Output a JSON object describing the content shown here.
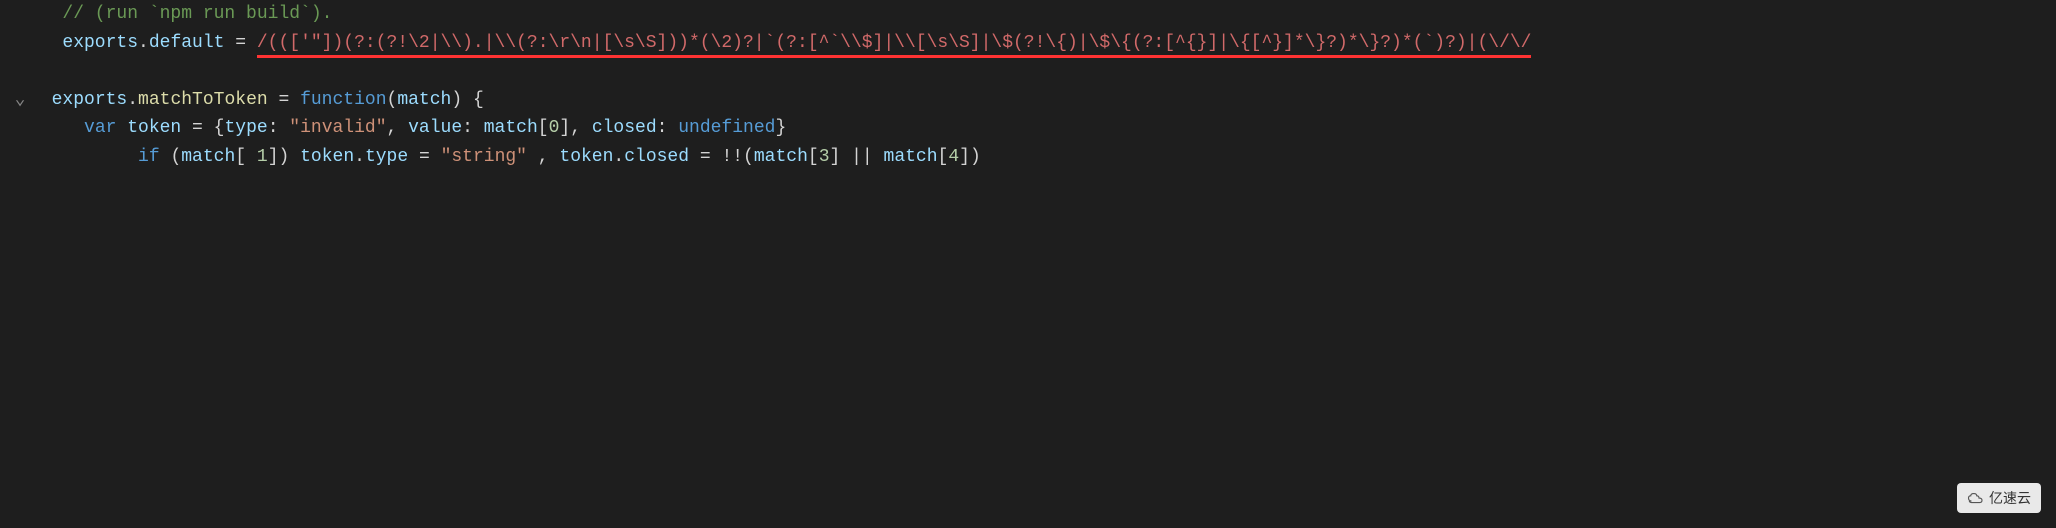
{
  "code": {
    "line1": {
      "comment": "// (run `npm run build`)."
    },
    "line2": {
      "prefix_exports": "exports",
      "dot1": ".",
      "default_prop": "default",
      "equals": " = ",
      "regex_text": "/((['\"])(?:(?!\\2|\\\\).|\\\\(?:\\r\\n|[\\s\\S]))*(\\2)?|`(?:[^`\\\\$]|\\\\[\\s\\S]|\\$(?!\\{)|\\$\\{(?:[^{}]|\\{[^}]*\\}?)*\\}?)*(`)?)|(\\/\\/"
    },
    "line3": {
      "exports": "exports",
      "dot": ".",
      "matchToToken": "matchToToken",
      "equals": " = ",
      "function_kw": "function",
      "paren_open": "(",
      "param": "match",
      "paren_close": ")",
      "brace_open": " {"
    },
    "line4": {
      "var_kw": "var",
      "token_var": " token ",
      "equals": "= ",
      "brace_open": "{",
      "type_key": "type",
      "colon1": ": ",
      "invalid_str": "\"invalid\"",
      "comma1": ", ",
      "value_key": "value",
      "colon2": ": ",
      "match_var": "match",
      "bracket_open": "[",
      "zero": "0",
      "bracket_close": "]",
      "comma2": ", ",
      "closed_key": "closed",
      "colon3": ": ",
      "undefined_kw": "undefined",
      "brace_close": "}"
    },
    "line5": {
      "if_kw": "if",
      "paren_open": " (",
      "match1": "match",
      "bracket1_open": "[ ",
      "one": "1",
      "bracket1_close": "]",
      "paren_close": ") ",
      "token1": "token",
      "dot1": ".",
      "type_prop": "type",
      "eq1": " = ",
      "string_str": "\"string\"",
      "spacer": " , ",
      "token2": "token",
      "dot2": ".",
      "closed_prop": "closed",
      "eq2": " = ",
      "bang": "!!",
      "paren2_open": "(",
      "match3": "match",
      "bracket3_open": "[",
      "three": "3",
      "bracket3_close": "]",
      "or_op": " || ",
      "match4": "match",
      "bracket4_open": "[",
      "four": "4",
      "bracket4_close": "]",
      "paren2_close": ")"
    }
  },
  "watermark": {
    "text": "亿速云"
  }
}
